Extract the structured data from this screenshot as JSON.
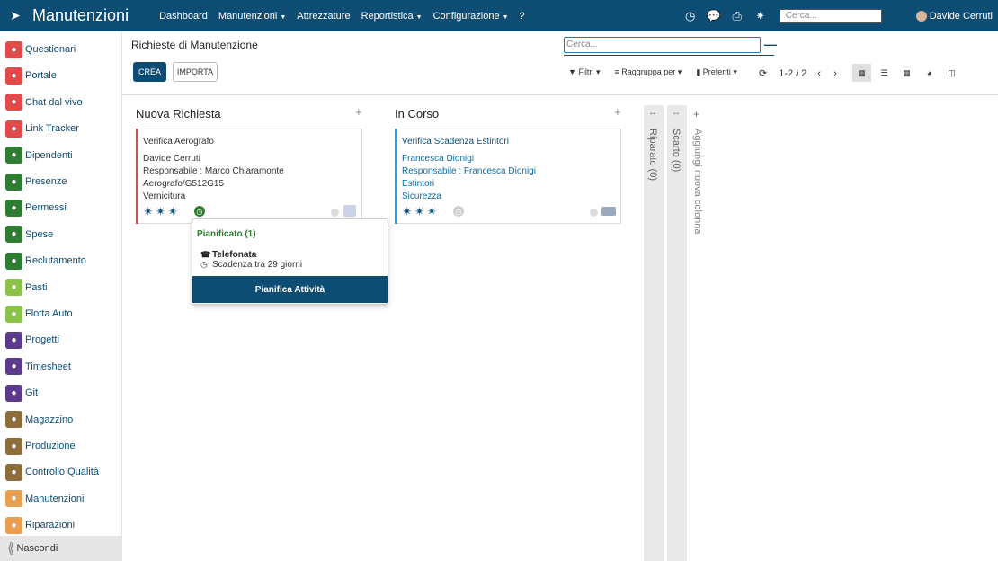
{
  "app": {
    "title": "Manutenzioni"
  },
  "nav": {
    "items": [
      {
        "label": "Dashboard"
      },
      {
        "label": "Manutenzioni",
        "dropdown": true
      },
      {
        "label": "Attrezzature"
      },
      {
        "label": "Reportistica",
        "dropdown": true
      },
      {
        "label": "Configurazione",
        "dropdown": true
      },
      {
        "label": "?"
      }
    ],
    "search_placeholder": "Cerca...",
    "user": "Davide Cerruti"
  },
  "sidebar": {
    "items": [
      {
        "label": "Questionari",
        "icon": "clipboard-icon",
        "color": "#e04a4a"
      },
      {
        "label": "Portale",
        "icon": "globe-icon",
        "color": "#e04a4a"
      },
      {
        "label": "Chat dal vivo",
        "icon": "chat-icon",
        "color": "#e04a4a"
      },
      {
        "label": "Link Tracker",
        "icon": "link-icon",
        "color": "#e04a4a"
      },
      {
        "label": "Dipendenti",
        "icon": "users-icon",
        "color": "#2e7d32"
      },
      {
        "label": "Presenze",
        "icon": "user-check-icon",
        "color": "#2e7d32"
      },
      {
        "label": "Permessi",
        "icon": "cog-icon",
        "color": "#2e7d32"
      },
      {
        "label": "Spese",
        "icon": "dollar-icon",
        "color": "#2e7d32"
      },
      {
        "label": "Reclutamento",
        "icon": "search-user-icon",
        "color": "#2e7d32"
      },
      {
        "label": "Pasti",
        "icon": "cutlery-icon",
        "color": "#8bc34a"
      },
      {
        "label": "Flotta Auto",
        "icon": "car-icon",
        "color": "#8bc34a"
      },
      {
        "label": "Progetti",
        "icon": "puzzle-icon",
        "color": "#5b3a8c"
      },
      {
        "label": "Timesheet",
        "icon": "clock-icon",
        "color": "#5b3a8c"
      },
      {
        "label": "Git",
        "icon": "git-icon",
        "color": "#5b3a8c"
      },
      {
        "label": "Magazzino",
        "icon": "box-icon",
        "color": "#8d6e3a"
      },
      {
        "label": "Produzione",
        "icon": "wrench-icon",
        "color": "#8d6e3a"
      },
      {
        "label": "Controllo Qualità",
        "icon": "badge-icon",
        "color": "#8d6e3a"
      },
      {
        "label": "Manutenzioni",
        "icon": "hammer-icon",
        "color": "#e8a050"
      },
      {
        "label": "Riparazioni",
        "icon": "tools-icon",
        "color": "#e8a050"
      }
    ],
    "collapse_label": "Nascondi"
  },
  "control": {
    "breadcrumb": "Richieste di Manutenzione",
    "search_placeholder": "Cerca...",
    "create_label": "CREA",
    "import_label": "IMPORTA",
    "filters_label": "Filtri",
    "groupby_label": "Raggruppa per",
    "favorites_label": "Preferiti",
    "pager": "1-2 / 2"
  },
  "kanban": {
    "columns": [
      {
        "title": "Nuova Richiesta"
      },
      {
        "title": "In Corso"
      }
    ],
    "folded": [
      {
        "title": "Riparato (0)"
      },
      {
        "title": "Scarto (0)"
      }
    ],
    "add_column_label": "Aggiungi nuova colonna",
    "cards": [
      {
        "title": "Verifica Aerografo",
        "lines": [
          "Davide Cerruti",
          "Responsabile : Marco Chiaramonte",
          "Aerografo/G512G15",
          "Vernicitura"
        ],
        "priority": 3,
        "accent": "#e04a4a"
      },
      {
        "title": "Verifica Scadenza Estintori",
        "lines": [
          "Francesca Dionigi",
          "Responsabile : Francesca Dionigi",
          "Estintori",
          "Sicurezza"
        ],
        "priority": 3,
        "accent": "#2ea0d8"
      }
    ]
  },
  "popover": {
    "title": "Pianificato (1)",
    "activity_type": "Telefonata",
    "due": "Scadenza tra 29 giorni",
    "button": "Pianifica Attività"
  }
}
